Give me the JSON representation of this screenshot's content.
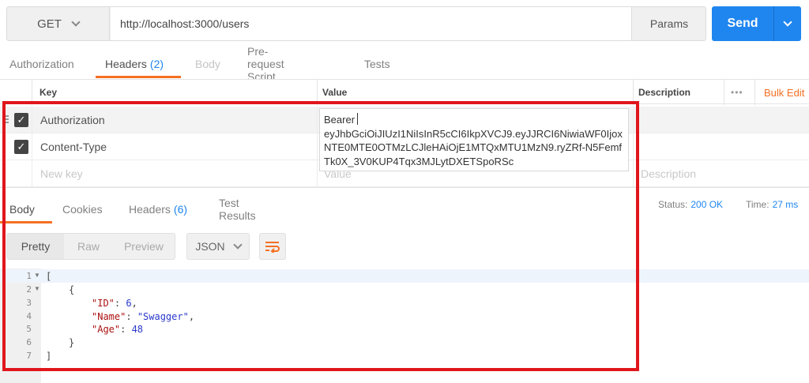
{
  "request": {
    "method": "GET",
    "url": "http://localhost:3000/users",
    "params_label": "Params",
    "send_label": "Send"
  },
  "request_tabs": [
    {
      "label": "Authorization",
      "count": ""
    },
    {
      "label": "Headers",
      "count": "(2)"
    },
    {
      "label": "Body",
      "count": ""
    },
    {
      "label": "Pre-request Script",
      "count": ""
    },
    {
      "label": "Tests",
      "count": ""
    }
  ],
  "headers_table": {
    "columns": {
      "key": "Key",
      "value": "Value",
      "description": "Description"
    },
    "more_label": "•••",
    "bulk_edit_label": "Bulk Edit",
    "rows": [
      {
        "key": "Authorization",
        "checked": true
      },
      {
        "key": "Content-Type",
        "checked": true
      }
    ],
    "new_row": {
      "key_placeholder": "New key",
      "value_placeholder": "Value",
      "description_placeholder": "Description"
    },
    "value_editor": "Bearer eyJhbGciOiJIUzI1NiIsInR5cCI6IkpXVCJ9.eyJJRCI6NiwiaWF0IjoxNTE0MTE0OTMzLCJleHAiOjE1MTQxMTU1MzN9.ryZRf-N5FemfTk0X_3V0KUP4Tqx3MJLytDXETSpoRSc"
  },
  "response_tabs": [
    {
      "label": "Body",
      "count": ""
    },
    {
      "label": "Cookies",
      "count": ""
    },
    {
      "label": "Headers",
      "count": "(6)"
    },
    {
      "label": "Test Results",
      "count": ""
    }
  ],
  "response_status": {
    "status_label": "Status:",
    "status_value": "200 OK",
    "time_label": "Time:",
    "time_value": "27 ms"
  },
  "body_view": {
    "modes": [
      "Pretty",
      "Raw",
      "Preview"
    ],
    "format": "JSON"
  },
  "code_lines": [
    "1",
    "2",
    "3",
    "4",
    "5",
    "6",
    "7"
  ],
  "response_json": {
    "open_bracket": "[",
    "open_brace": "{",
    "id_key": "\"ID\"",
    "id_value": "6",
    "name_key": "\"Name\"",
    "name_value": "\"Swagger\"",
    "age_key": "\"Age\"",
    "age_value": "48",
    "close_brace": "}",
    "close_bracket": "]"
  },
  "colors": {
    "accent": "#f47023",
    "send": "#1f86f0",
    "highlight_box": "#e0161c"
  }
}
